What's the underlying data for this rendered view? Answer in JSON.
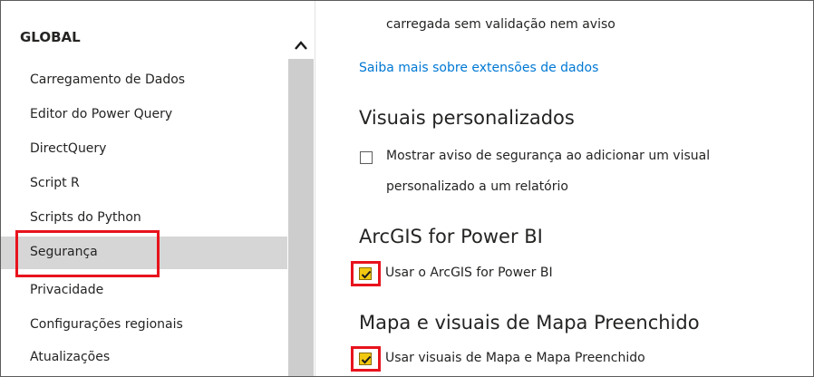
{
  "sidebar": {
    "section_title": "GLOBAL",
    "items": [
      {
        "label": "Carregamento de Dados"
      },
      {
        "label": "Editor do Power Query"
      },
      {
        "label": "DirectQuery"
      },
      {
        "label": "Script R"
      },
      {
        "label": "Scripts do Python"
      },
      {
        "label": "Segurança",
        "selected": true
      },
      {
        "label": "Privacidade"
      },
      {
        "label": "Configurações regionais"
      },
      {
        "label": "Atualizações"
      }
    ]
  },
  "content": {
    "prev_text": "carregada sem validação nem aviso",
    "learn_more_link": "Saiba mais sobre extensões de dados",
    "custom_visuals": {
      "heading": "Visuais personalizados",
      "checkbox_line1": "Mostrar aviso de segurança ao adicionar um visual",
      "checkbox_line2": "personalizado a um relatório",
      "checked": false
    },
    "arcgis": {
      "heading": "ArcGIS for Power BI",
      "checkbox_label": "Usar o ArcGIS for Power BI",
      "checked": true
    },
    "map_visuals": {
      "heading": "Mapa e visuais de Mapa Preenchido",
      "checkbox_label": "Usar visuais de Mapa e Mapa Preenchido",
      "checked": true
    }
  },
  "colors": {
    "highlight": "#e8131d",
    "checkbox_checked": "#f2c811",
    "link": "#0078d4",
    "selected_bg": "#d6d6d6"
  }
}
